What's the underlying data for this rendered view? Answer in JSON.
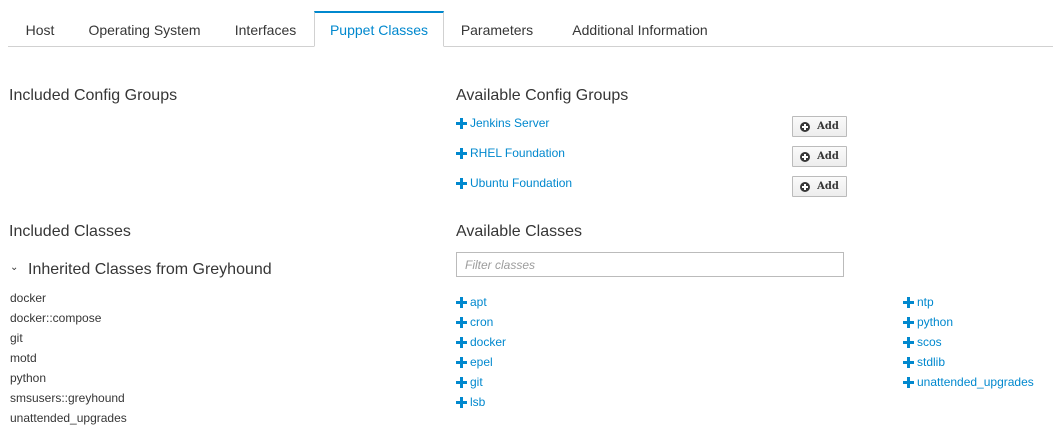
{
  "tabs": [
    {
      "label": "Host"
    },
    {
      "label": "Operating System"
    },
    {
      "label": "Interfaces"
    },
    {
      "label": "Puppet Classes"
    },
    {
      "label": "Parameters"
    },
    {
      "label": "Additional Information"
    }
  ],
  "active_tab": "Puppet Classes",
  "included_config_groups": {
    "title": "Included Config Groups"
  },
  "available_config_groups": {
    "title": "Available Config Groups",
    "items": [
      {
        "label": "Jenkins Server",
        "button": "Add"
      },
      {
        "label": "RHEL Foundation",
        "button": "Add"
      },
      {
        "label": "Ubuntu Foundation",
        "button": "Add"
      }
    ]
  },
  "included_classes": {
    "title": "Included Classes",
    "inherited_title": "Inherited Classes from Greyhound",
    "items": [
      "docker",
      "docker::compose",
      "git",
      "motd",
      "python",
      "smsusers::greyhound",
      "unattended_upgrades"
    ]
  },
  "available_classes": {
    "title": "Available Classes",
    "filter_placeholder": "Filter classes",
    "col1": [
      "apt",
      "cron",
      "docker",
      "epel",
      "git",
      "lsb"
    ],
    "col2": [
      "ntp",
      "python",
      "scos",
      "stdlib",
      "unattended_upgrades"
    ]
  },
  "colors": {
    "accent": "#0088ce",
    "text": "#363636",
    "border": "#d1d1d1"
  },
  "icons": {
    "add_link": "plus-icon",
    "add_button": "circle-plus-icon",
    "collapse": "chevron-down-icon"
  }
}
